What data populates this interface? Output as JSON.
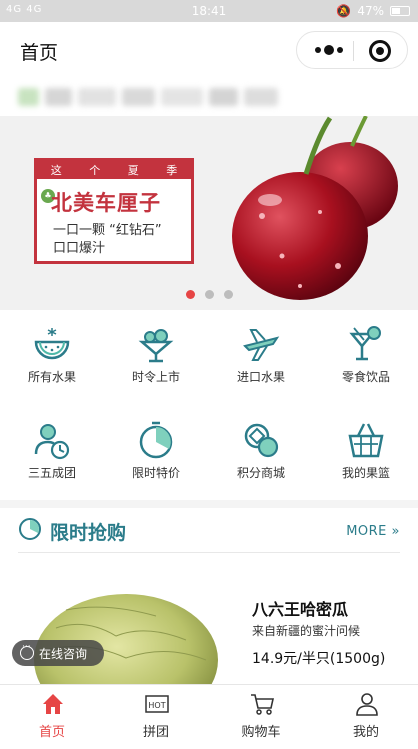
{
  "status_bar": {
    "signal": "4G 4G",
    "time": "18:41",
    "battery": "47%"
  },
  "nav": {
    "title": "首页"
  },
  "banner": {
    "head": [
      "这",
      "个",
      "夏",
      "季"
    ],
    "headline": "北美车厘子",
    "line1": "一口一颗 “红钻石”",
    "line2": "口口爆汁",
    "active_slide": 1,
    "slides": 3
  },
  "categories": [
    {
      "label": "所有水果",
      "icon": "watermelon-icon"
    },
    {
      "label": "时令上市",
      "icon": "ice-cream-icon"
    },
    {
      "label": "进口水果",
      "icon": "airplane-icon"
    },
    {
      "label": "零食饮品",
      "icon": "cocktail-icon"
    },
    {
      "label": "三五成团",
      "icon": "group-clock-icon"
    },
    {
      "label": "限时特价",
      "icon": "timer-icon"
    },
    {
      "label": "积分商城",
      "icon": "coins-icon"
    },
    {
      "label": "我的果篮",
      "icon": "basket-icon"
    }
  ],
  "flash_sale": {
    "title": "限时抢购",
    "more": "MORE"
  },
  "product": {
    "name": "八六王哈密瓜",
    "subtitle": "来自新疆的蜜汁问候",
    "price": "14.9元/半只(1500g)"
  },
  "consult": {
    "label": "在线咨询"
  },
  "tabs": [
    {
      "label": "首页",
      "icon": "home-icon",
      "active": true
    },
    {
      "label": "拼团",
      "icon": "hot-icon",
      "active": false
    },
    {
      "label": "购物车",
      "icon": "cart-icon",
      "active": false
    },
    {
      "label": "我的",
      "icon": "user-icon",
      "active": false
    }
  ],
  "colors": {
    "accent": "#e64545",
    "teal": "#2b7c8a",
    "banner_red": "#c3333e"
  }
}
